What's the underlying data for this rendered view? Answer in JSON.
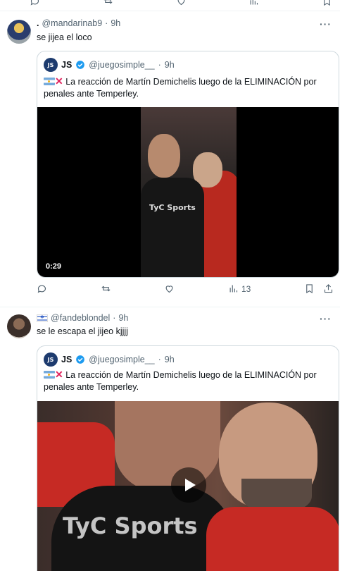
{
  "tweets": [
    {
      "display_name": ".",
      "handle": "@mandarinab9",
      "time": "9h",
      "text": "se jijea el loco",
      "quote": {
        "avatar_text": "JS",
        "name": "JS",
        "handle": "@juegosimple__",
        "time": "9h",
        "text": "La reacción de Martín Demichelis luego de la ELIMINACIÓN por penales ante Temperley.",
        "video_duration": "0:29",
        "watermark": "TyC Sports"
      },
      "actions": {
        "views": "13"
      }
    },
    {
      "display_name": "",
      "handle": "@fandeblondel",
      "time": "9h",
      "text": "se le escapa el jijeo kjjjj",
      "quote": {
        "avatar_text": "JS",
        "name": "JS",
        "handle": "@juegosimple__",
        "time": "9h",
        "text": "La reacción de Martín Demichelis luego de la ELIMINACIÓN por penales ante Temperley.",
        "watermark": "TyC Sports"
      }
    }
  ],
  "colors": {
    "secondary_text": "#536471",
    "border": "#cfd9de",
    "verified_blue": "#1d9bf0",
    "x_mark": "#e0245e"
  },
  "icons": [
    "reply-icon",
    "retweet-icon",
    "like-icon",
    "views-icon",
    "bookmark-icon",
    "share-icon",
    "more-icon",
    "play-icon",
    "verified-icon",
    "flag-argentina-icon",
    "flag-israel-icon"
  ]
}
